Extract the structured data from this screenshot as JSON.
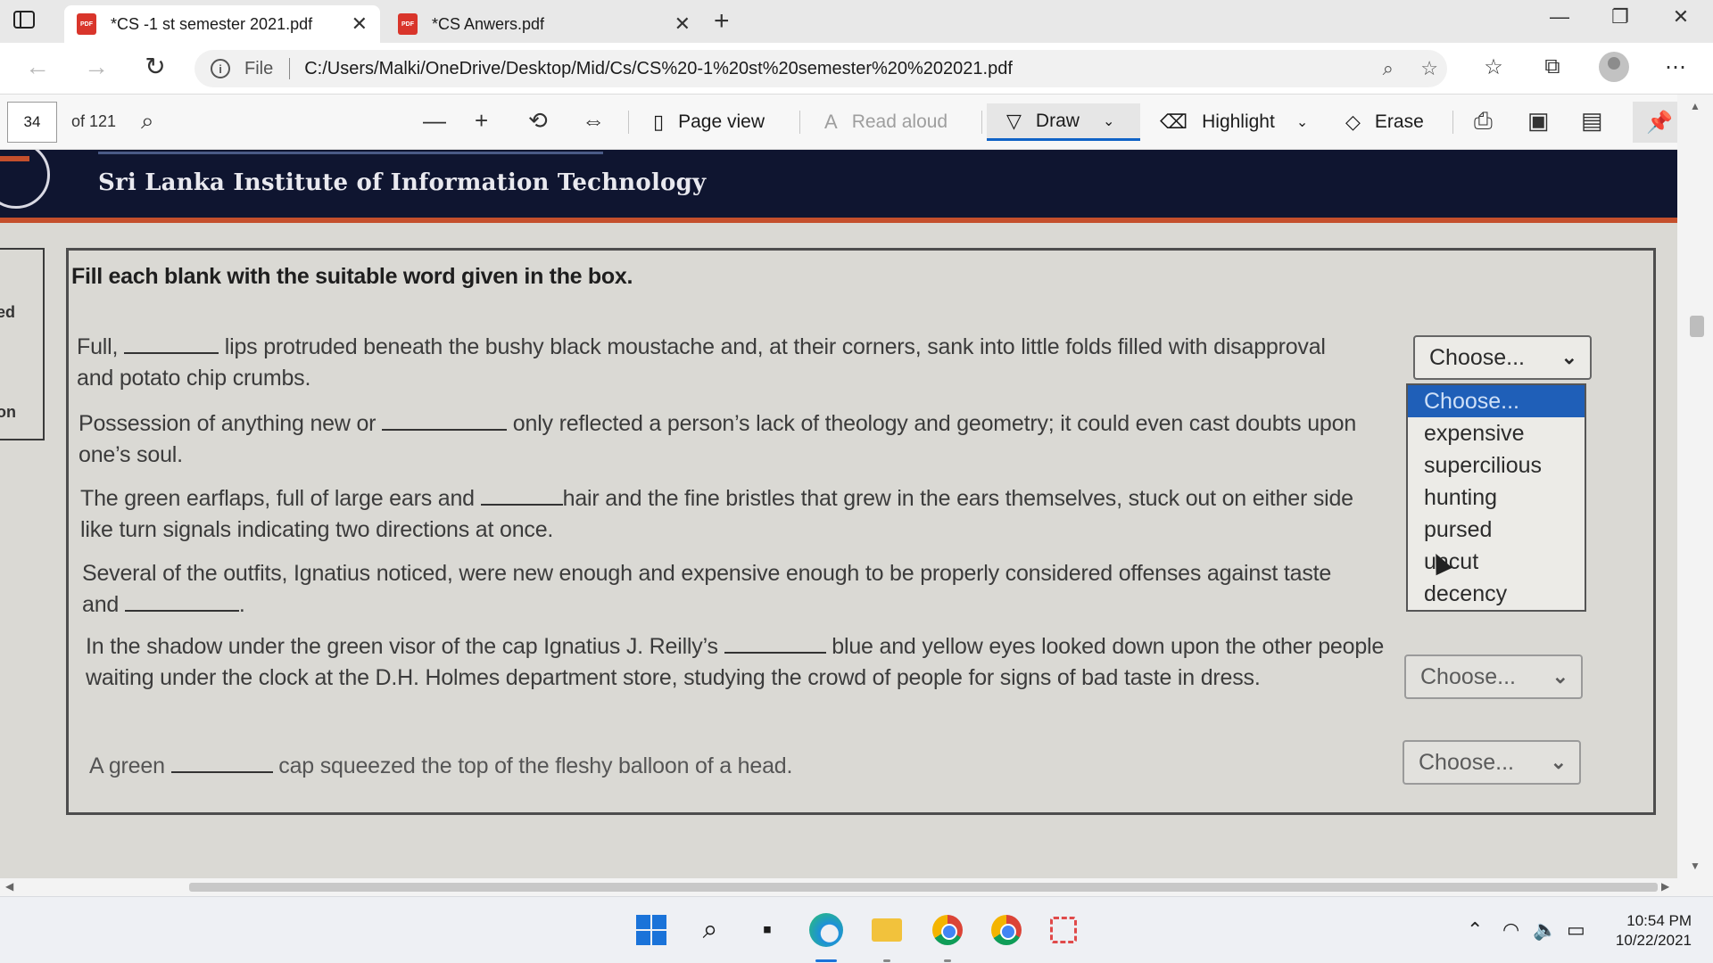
{
  "browser": {
    "tabs": [
      {
        "title": "*CS -1 st semester 2021.pdf",
        "active": true
      },
      {
        "title": "*CS Anwers.pdf",
        "active": false
      }
    ],
    "address": {
      "file_label": "File",
      "url": "C:/Users/Malki/OneDrive/Desktop/Mid/Cs/CS%20-1%20st%20semester%20%202021.pdf"
    }
  },
  "pdf_toolbar": {
    "page_number": "34",
    "page_total": "of 121",
    "page_view": "Page view",
    "read_aloud": "Read aloud",
    "draw": "Draw",
    "highlight": "Highlight",
    "erase": "Erase"
  },
  "document": {
    "banner_title": "Sri Lanka Institute of Information Technology",
    "left_fragments": [
      "ed",
      "on"
    ],
    "instruction": "Fill each blank with the suitable word given in the box.",
    "questions": [
      {
        "before": "Full, ",
        "after": " lips protruded beneath the bushy black moustache and, at their corners, sank into little folds filled with disapproval and potato chip crumbs."
      },
      {
        "before": "Possession of anything new or ",
        "after": " only reflected a person’s lack of theology and geometry; it could even cast doubts upon one’s soul."
      },
      {
        "before": "The green earflaps, full of large ears and ",
        "after": "hair and the fine bristles that grew in the ears themselves, stuck out on either side like turn signals indicating two directions at once."
      },
      {
        "before": "Several of the outfits, Ignatius noticed, were new enough and expensive enough to be properly considered offenses against taste and ",
        "after": "."
      },
      {
        "before": "In the shadow under the green visor of the cap Ignatius J. Reilly’s ",
        "after": " blue and yellow eyes looked down upon the other people waiting under the clock at the D.H. Holmes department store, studying the crowd of people for signs of bad taste in dress."
      },
      {
        "before": "A green ",
        "after": " cap squeezed the top of the fleshy balloon of a head."
      }
    ],
    "select_value": "Choose...",
    "dropdown_options": [
      "Choose...",
      "expensive",
      "supercilious",
      "hunting",
      "pursed",
      "uncut",
      "decency"
    ],
    "dropdown_selected_index": 0
  },
  "taskbar": {
    "time": "10:54 PM",
    "date": "10/22/2021"
  },
  "colors": {
    "accent": "#0f63c6",
    "banner": "#0f1530",
    "banner_stripe": "#c44f2c",
    "dropdown_highlight": "#1f5fb8"
  }
}
